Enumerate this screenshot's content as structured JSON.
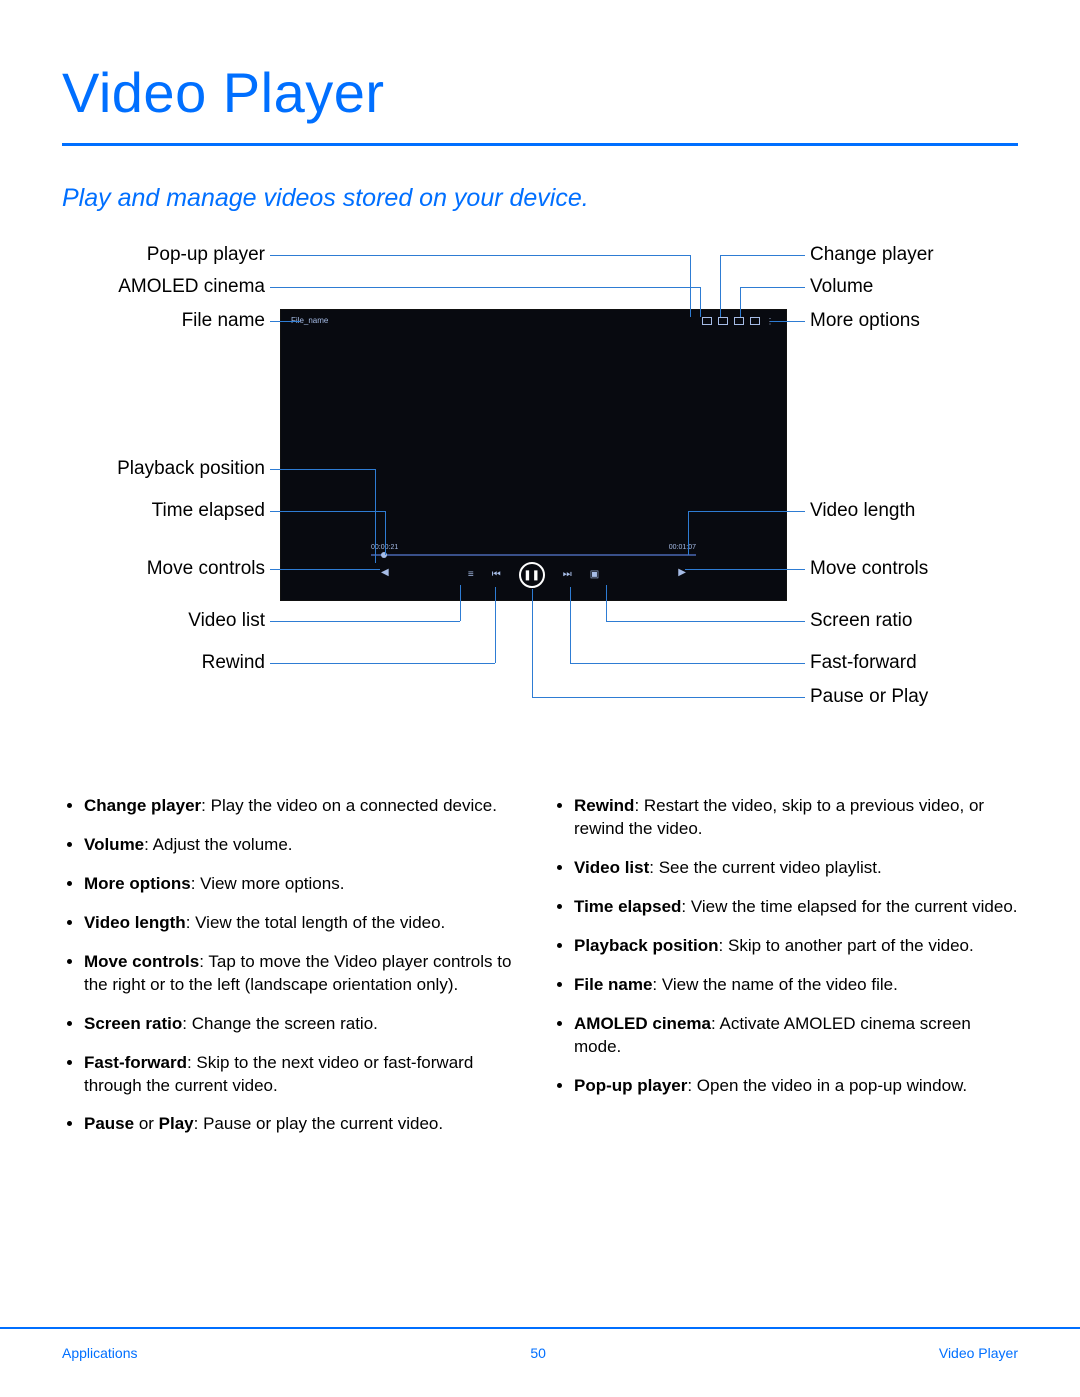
{
  "title": "Video Player",
  "subtitle": "Play and manage videos stored on your device.",
  "labels_left": {
    "popup": "Pop-up player",
    "amoled": "AMOLED cinema",
    "file_name": "File name",
    "playback": "Playback position",
    "elapsed": "Time elapsed",
    "move": "Move controls",
    "list": "Video list",
    "rewind": "Rewind"
  },
  "labels_right": {
    "change": "Change player",
    "volume": "Volume",
    "more": "More options",
    "length": "Video length",
    "move": "Move controls",
    "ratio": "Screen ratio",
    "ffwd": "Fast-forward",
    "pause": "Pause or Play"
  },
  "player": {
    "file_name": "File_name",
    "time_elapsed": "00:00:21",
    "time_total": "00:01:07"
  },
  "bullets_left": [
    {
      "term": "Change player",
      "desc": ": Play the video on a connected device."
    },
    {
      "term": "Volume",
      "desc": ": Adjust the volume."
    },
    {
      "term": "More options",
      "desc": ": View more options."
    },
    {
      "term": "Video length",
      "desc": ": View the total length of the video."
    },
    {
      "term": "Move controls",
      "desc": ": Tap to move the Video player controls to the right or to the left (landscape orientation only)."
    },
    {
      "term": "Screen ratio",
      "desc": ": Change the screen ratio."
    },
    {
      "term": "Fast-forward",
      "desc": ": Skip to the next video or fast-forward through the current video."
    },
    {
      "term_prefix": "Pause",
      "mid": " or ",
      "term_suffix": "Play",
      "desc": ": Pause or play the current video."
    }
  ],
  "bullets_right": [
    {
      "term": "Rewind",
      "desc": ": Restart the video, skip to a previous video, or rewind the video."
    },
    {
      "term": "Video list",
      "desc": ": See the current video playlist."
    },
    {
      "term": "Time elapsed",
      "desc": ": View the time elapsed for the current video."
    },
    {
      "term": "Playback position",
      "desc": ": Skip to another part of the video."
    },
    {
      "term": "File name",
      "desc": ": View the name of the video file."
    },
    {
      "term": "AMOLED cinema",
      "desc": ": Activate AMOLED cinema screen mode."
    },
    {
      "term": "Pop-up player",
      "desc": ": Open the video in a pop-up window."
    }
  ],
  "footer": {
    "left": "Applications",
    "center": "50",
    "right": "Video Player"
  }
}
